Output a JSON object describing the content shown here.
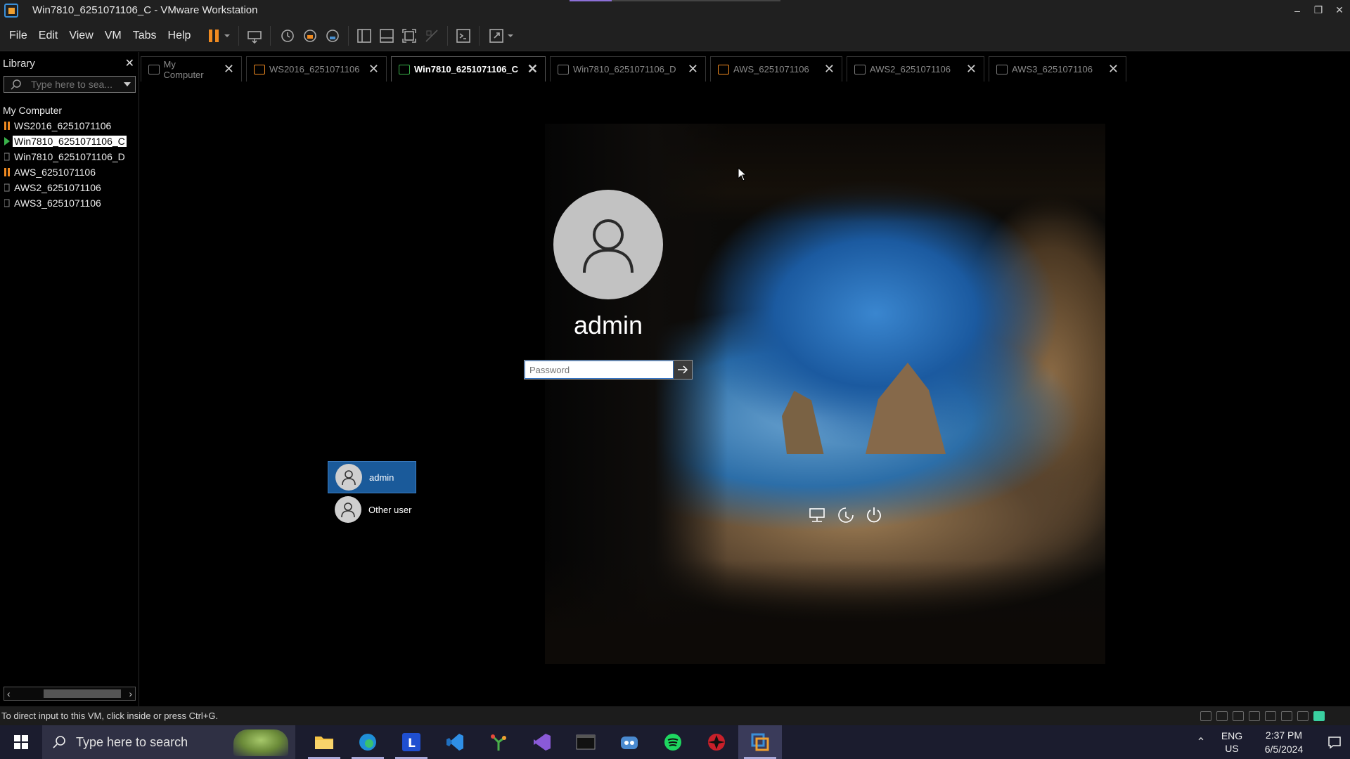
{
  "window": {
    "title": "Win7810_6251071106_C - VMware Workstation",
    "controls": [
      "–",
      "❐",
      "✕"
    ]
  },
  "menu": [
    "File",
    "Edit",
    "View",
    "VM",
    "Tabs",
    "Help"
  ],
  "library": {
    "header": "Library",
    "search_placeholder": "Type here to sea...",
    "root": "My Computer",
    "items": [
      {
        "label": "WS2016_6251071106",
        "state": "paused"
      },
      {
        "label": "Win7810_6251071106_C",
        "state": "running",
        "selected": true
      },
      {
        "label": "Win7810_6251071106_D",
        "state": "off"
      },
      {
        "label": "AWS_6251071106",
        "state": "paused"
      },
      {
        "label": "AWS2_6251071106",
        "state": "off"
      },
      {
        "label": "AWS3_6251071106",
        "state": "off"
      }
    ]
  },
  "tabs": [
    {
      "label": "My Computer",
      "active": false
    },
    {
      "label": "WS2016_6251071106",
      "active": false
    },
    {
      "label": "Win7810_6251071106_C",
      "active": true
    },
    {
      "label": "Win7810_6251071106_D",
      "active": false
    },
    {
      "label": "AWS_6251071106",
      "active": false
    },
    {
      "label": "AWS2_6251071106",
      "active": false
    },
    {
      "label": "AWS3_6251071106",
      "active": false
    }
  ],
  "lock_screen": {
    "username": "admin",
    "password_placeholder": "Password",
    "users": [
      {
        "label": "admin",
        "active": true
      },
      {
        "label": "Other user",
        "active": false
      }
    ]
  },
  "status_bar": {
    "message": "To direct input to this VM, click inside or press Ctrl+G."
  },
  "taskbar": {
    "search_placeholder": "Type here to search",
    "apps": [
      "file-explorer",
      "edge",
      "l-app",
      "vscode",
      "sourcetree",
      "visual-studio",
      "terminal",
      "game-app",
      "spotify",
      "security-app",
      "vmware"
    ],
    "language_line1": "ENG",
    "language_line2": "US",
    "time": "2:37 PM",
    "date": "6/5/2024"
  },
  "colors": {
    "accent": "#1a5a9a",
    "pause": "#f08a20",
    "taskbar": "#1b1c2e"
  }
}
